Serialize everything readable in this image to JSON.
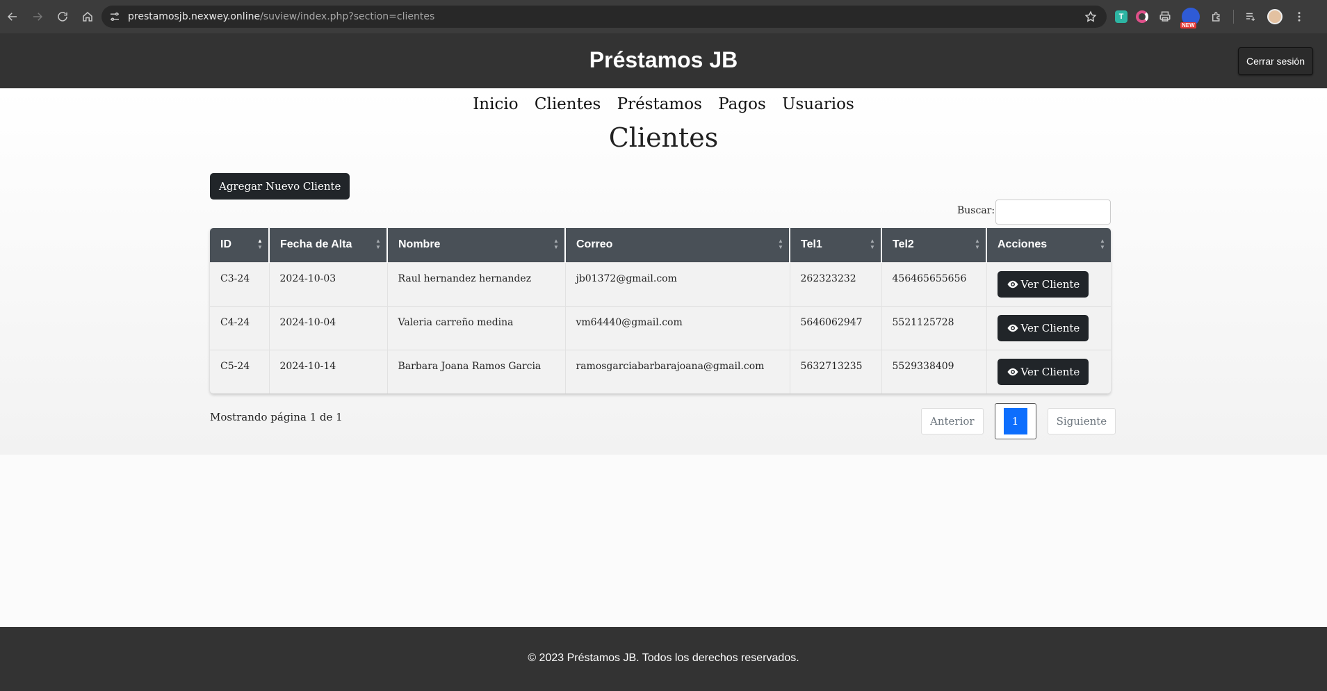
{
  "browser": {
    "url_host": "prestamosjb.nexwey.online",
    "url_path": "/suview/index.php?section=clientes",
    "ext_t": "T",
    "ext_new": "NEW"
  },
  "header": {
    "title": "Préstamos JB",
    "logout_label": "Cerrar sesión"
  },
  "nav": {
    "items": [
      "Inicio",
      "Clientes",
      "Préstamos",
      "Pagos",
      "Usuarios"
    ]
  },
  "page": {
    "title": "Clientes",
    "add_button": "Agregar Nuevo Cliente",
    "search_label": "Buscar:",
    "search_value": ""
  },
  "table": {
    "headers": [
      "ID",
      "Fecha de Alta",
      "Nombre",
      "Correo",
      "Tel1",
      "Tel2",
      "Acciones"
    ],
    "rows": [
      [
        "C3-24",
        "2024-10-03",
        "Raul hernandez hernandez",
        "jb01372@gmail.com",
        "262323232",
        "456465655656"
      ],
      [
        "C4-24",
        "2024-10-04",
        "Valeria carreño medina",
        "vm64440@gmail.com",
        "5646062947",
        "5521125728"
      ],
      [
        "C5-24",
        "2024-10-14",
        "Barbara Joana Ramos Garcia",
        "ramosgarciabarbarajoana@gmail.com",
        "5632713235",
        "5529338409"
      ]
    ],
    "action_label": "Ver Cliente"
  },
  "pagination": {
    "info": "Mostrando página 1 de 1",
    "prev": "Anterior",
    "current": "1",
    "next": "Siguiente"
  },
  "footer": {
    "text": "© 2023 Préstamos JB. Todos los derechos reservados."
  }
}
